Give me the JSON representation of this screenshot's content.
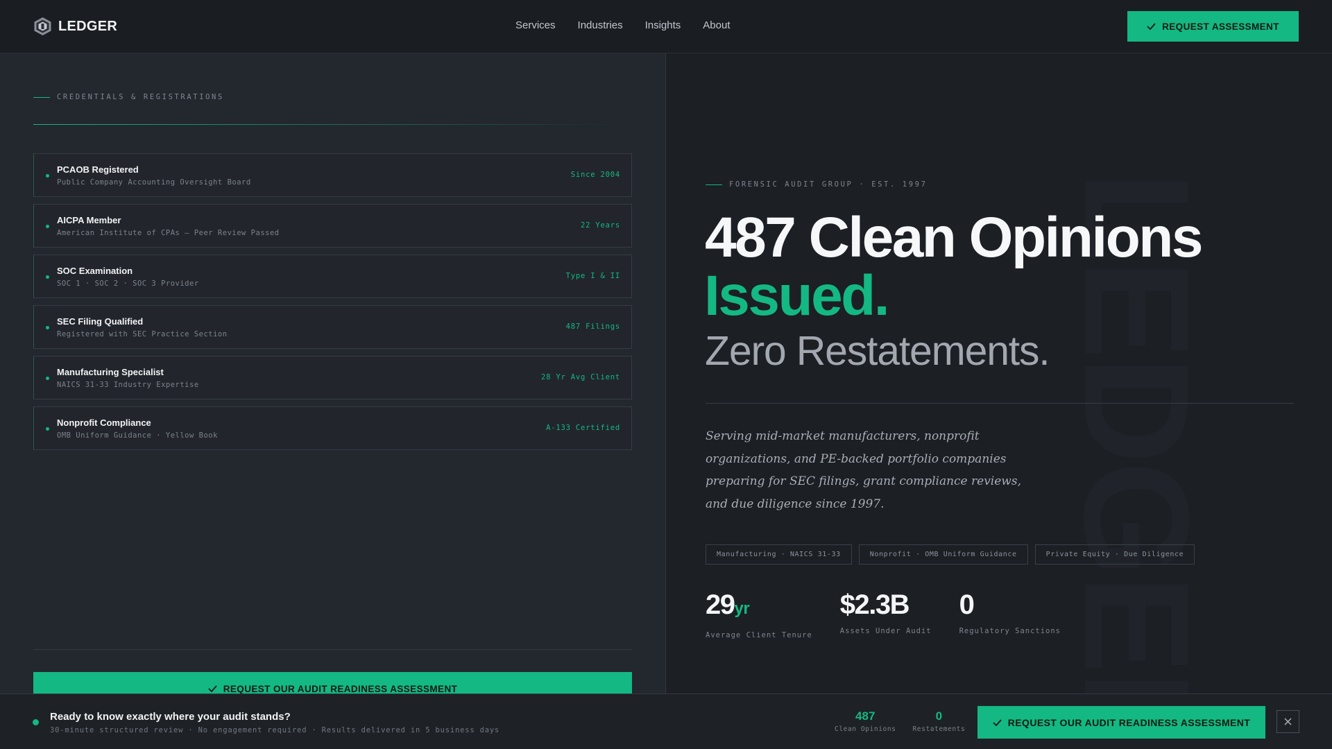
{
  "header": {
    "brand": "LEDGER",
    "nav": [
      "Services",
      "Industries",
      "Insights",
      "About"
    ],
    "cta_label": "REQUEST ASSESSMENT"
  },
  "credentials": {
    "eyebrow": "CREDENTIALS & REGISTRATIONS",
    "items": [
      {
        "title": "PCAOB Registered",
        "subtitle": "Public Company Accounting Oversight Board",
        "tag": "Since 2004"
      },
      {
        "title": "AICPA Member",
        "subtitle": "American Institute of CPAs — Peer Review Passed",
        "tag": "22 Years"
      },
      {
        "title": "SOC Examination",
        "subtitle": "SOC 1 · SOC 2 · SOC 3 Provider",
        "tag": "Type I & II"
      },
      {
        "title": "SEC Filing Qualified",
        "subtitle": "Registered with SEC Practice Section",
        "tag": "487 Filings"
      },
      {
        "title": "Manufacturing Specialist",
        "subtitle": "NAICS 31-33 Industry Expertise",
        "tag": "28 Yr Avg Client"
      },
      {
        "title": "Nonprofit Compliance",
        "subtitle": "OMB Uniform Guidance · Yellow Book",
        "tag": "A-133 Certified"
      }
    ],
    "cta_label": "REQUEST OUR AUDIT READINESS ASSESSMENT"
  },
  "hero": {
    "eyebrow": "FORENSIC AUDIT GROUP · EST. 1997",
    "watermark": "LEDGER",
    "headline": "487 Clean Opinions",
    "headline_accent": "Issued.",
    "headline_sub": "Zero Restatements.",
    "lede": "Serving mid-market manufacturers, nonprofit organizations, and PE-backed portfolio companies preparing for SEC filings, grant compliance reviews, and due diligence since 1997.",
    "tags": [
      "Manufacturing · NAICS 31-33",
      "Nonprofit · OMB Uniform Guidance",
      "Private Equity · Due Diligence"
    ],
    "stats": [
      {
        "value": "29",
        "unit": "yr",
        "label": "Average Client Tenure"
      },
      {
        "value": "$2.3B",
        "unit": "",
        "label": "Assets Under Audit"
      },
      {
        "value": "0",
        "unit": "",
        "label": "Regulatory Sanctions"
      }
    ]
  },
  "bottom_bar": {
    "title": "Ready to know exactly where your audit stands?",
    "subtitle": "30-minute structured review · No engagement required · Results delivered in 5 business days",
    "stats": [
      {
        "value": "487",
        "label": "Clean Opinions"
      },
      {
        "value": "0",
        "label": "Restatements"
      }
    ],
    "cta_label": "REQUEST OUR AUDIT READINESS ASSESSMENT",
    "close_icon": "close-icon"
  },
  "colors": {
    "accent": "#14b882",
    "background": "#1c1f24",
    "panel": "#23272e"
  }
}
